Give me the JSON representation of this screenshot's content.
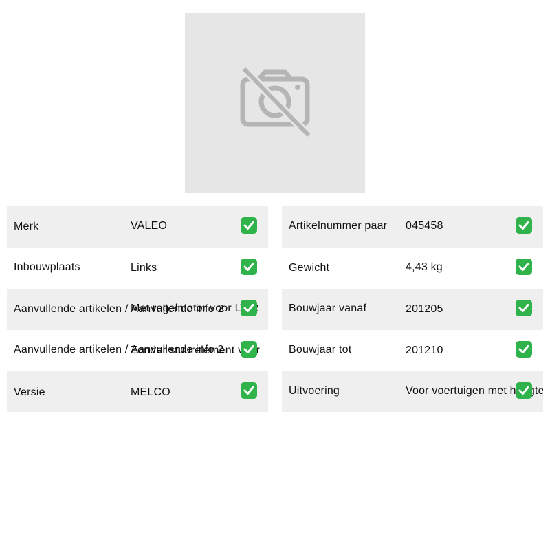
{
  "photo": {
    "icon": "camera-off-icon"
  },
  "left_table": [
    {
      "label": "Merk",
      "value": "VALEO",
      "status_icon": "check-icon"
    },
    {
      "label": "Inbouwplaats",
      "value": "Links",
      "status_icon": "check-icon"
    },
    {
      "label": "Aanvullende artikelen / Aanvullende info 2",
      "value": "Met regelmotor voor LWR",
      "status_icon": "check-icon"
    },
    {
      "label": "Aanvullende artikelen / Aanvullende info 2",
      "value": "Zonder stuurelement voor",
      "status_icon": "check-icon"
    },
    {
      "label": "Versie",
      "value": "MELCO",
      "status_icon": "check-icon"
    }
  ],
  "right_table": [
    {
      "label": "Artikelnummer paar",
      "value": "045458",
      "status_icon": "check-icon"
    },
    {
      "label": "Gewicht",
      "value": "4,43 kg",
      "status_icon": "check-icon"
    },
    {
      "label": "Bouwjaar vanaf",
      "value": "201205",
      "status_icon": "check-icon"
    },
    {
      "label": "Bouwjaar tot",
      "value": "201210",
      "status_icon": "check-icon"
    },
    {
      "label": "Uitvoering",
      "value": "Voor voertuigen met hoogteregeling",
      "status_icon": "check-icon"
    }
  ],
  "colors": {
    "check_bg": "#2fb34a",
    "row_shade": "#efefef",
    "photo_bg": "#e6e6e6",
    "icon_grey": "#b5b5b5"
  }
}
